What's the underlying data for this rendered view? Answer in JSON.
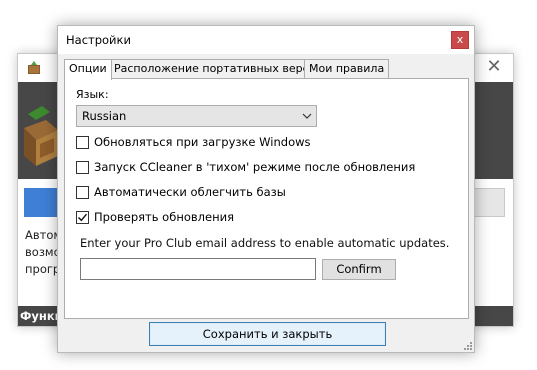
{
  "background_window": {
    "close_glyph": "✕",
    "text_lines": [
      "Автом",
      "возмо",
      "прогр"
    ],
    "footer_text": "Функц"
  },
  "dialog": {
    "title": "Настройки",
    "close_glyph": "x",
    "tabs": [
      {
        "label": "Опции",
        "active": true
      },
      {
        "label": "Расположение портативных версий",
        "active": false
      },
      {
        "label": "Мои правила",
        "active": false
      }
    ],
    "options": {
      "language_label": "Язык:",
      "language_value": "Russian",
      "checkboxes": [
        {
          "label": "Обновляться при загрузке Windows",
          "checked": false
        },
        {
          "label": "Запуск CCleaner в 'тихом' режиме после обновления",
          "checked": false
        },
        {
          "label": "Автоматически облегчить базы",
          "checked": false
        },
        {
          "label": "Проверять обновления",
          "checked": true
        }
      ],
      "pro_club_text": "Enter your Pro Club email address to enable automatic updates.",
      "email_value": "",
      "confirm_label": "Confirm"
    },
    "save_label": "Сохранить и закрыть"
  },
  "colors": {
    "close_button": "#c94a4a",
    "banner": "#474747",
    "accent_blue": "#3f7fd5",
    "save_border": "#3c7fb1"
  }
}
